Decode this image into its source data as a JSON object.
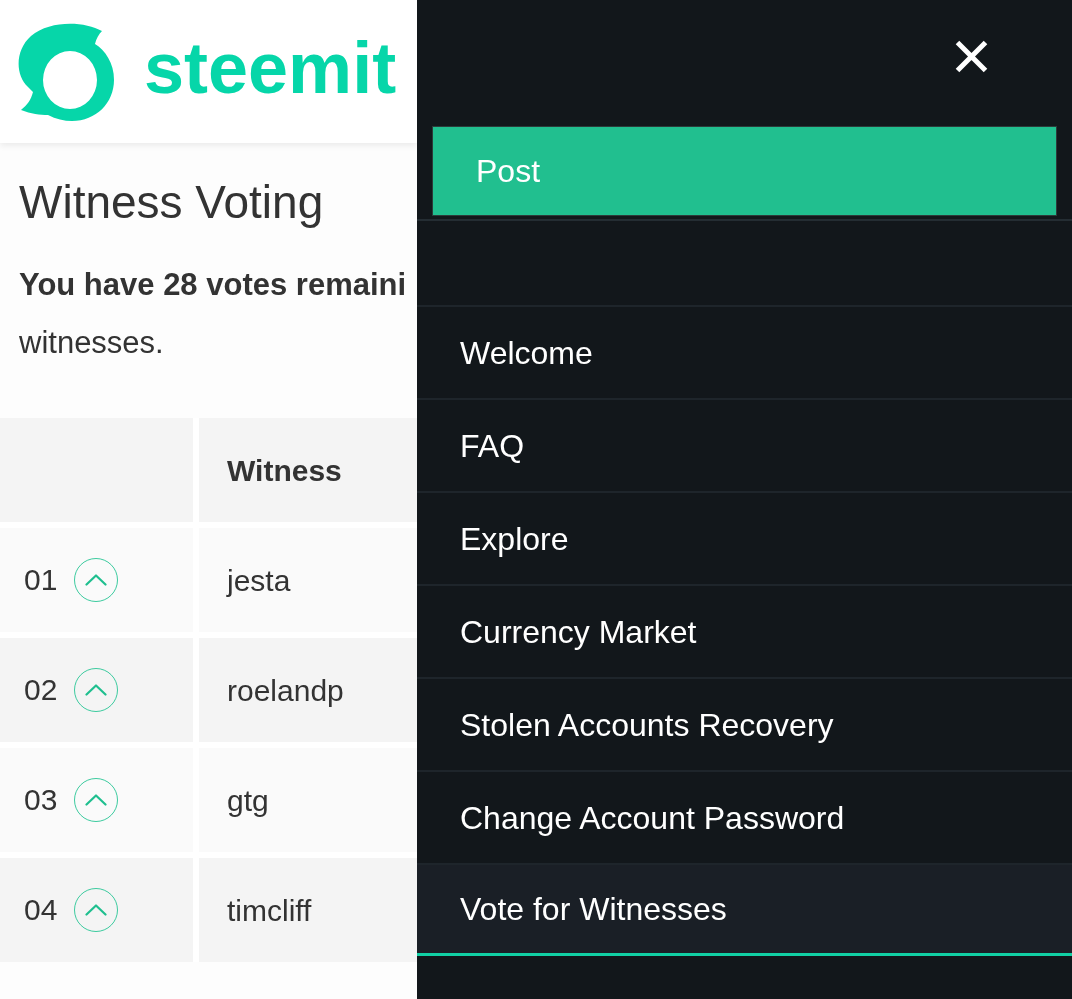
{
  "header": {
    "logo_text": "steemit"
  },
  "page": {
    "title": "Witness Voting",
    "notice_lines": [
      {
        "kind": "emphasis",
        "text": "You have 28 votes remaini"
      },
      {
        "kind": "plain",
        "text": "witnesses."
      }
    ]
  },
  "table": {
    "witness_heading": "Witness",
    "rows": [
      {
        "rank": "01",
        "witness": "jesta"
      },
      {
        "rank": "02",
        "witness": "roelandp"
      },
      {
        "rank": "03",
        "witness": "gtg"
      },
      {
        "rank": "04",
        "witness": "timcliff"
      }
    ]
  },
  "drawer": {
    "post_button": "Post",
    "items": [
      {
        "label": "Welcome",
        "selected": false
      },
      {
        "label": "FAQ",
        "selected": false
      },
      {
        "label": "Explore",
        "selected": false
      },
      {
        "label": "Currency Market",
        "selected": false
      },
      {
        "label": "Stolen Accounts Recovery",
        "selected": false
      },
      {
        "label": "Change Account Password",
        "selected": false
      },
      {
        "label": "Vote for Witnesses",
        "selected": true
      }
    ]
  }
}
